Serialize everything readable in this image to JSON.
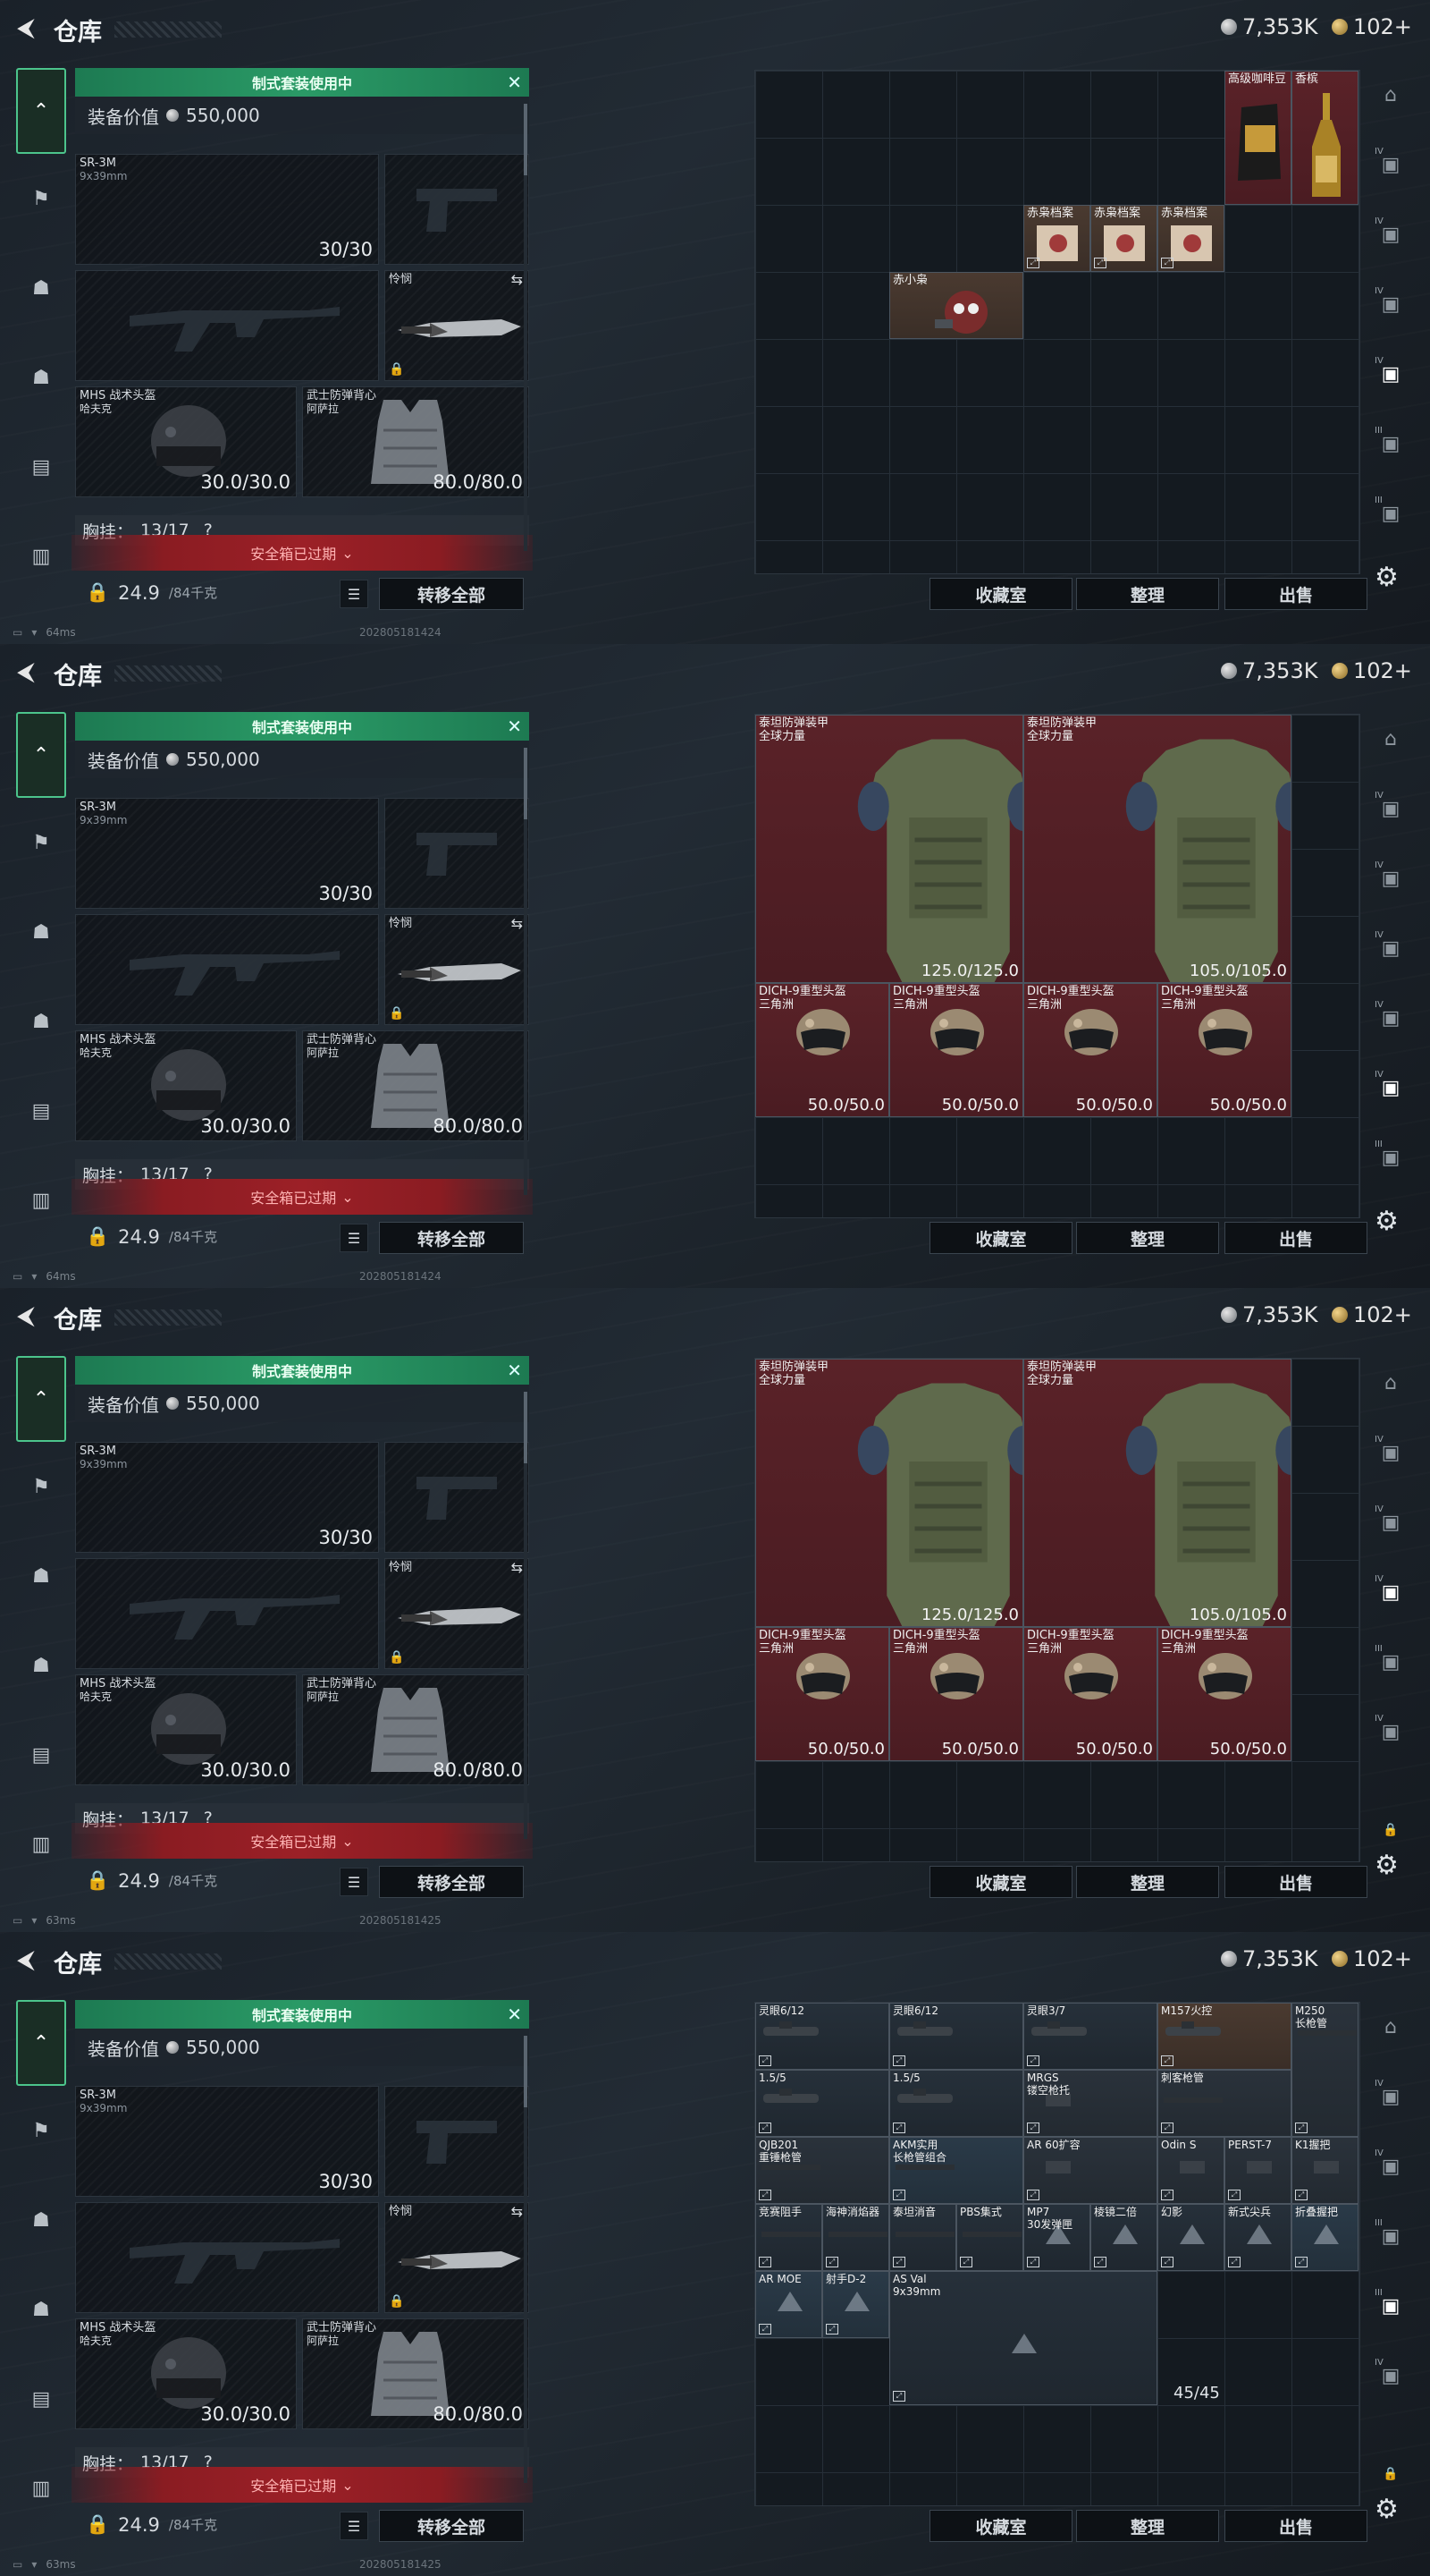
{
  "header": {
    "title": "仓库",
    "currency_silver": "7,353K",
    "currency_gold": "102+"
  },
  "loadout": {
    "kit_banner": "制式套装使用中",
    "value_label": "装备价值",
    "value": "550,000",
    "primary": {
      "name": "SR-3M",
      "caliber": "9x39mm",
      "ammo": "30/30"
    },
    "melee": {
      "name": "怜悯"
    },
    "helmet": {
      "name": "MHS 战术头盔",
      "sub": "哈夫克",
      "durability": "30.0/30.0"
    },
    "armor": {
      "name": "武士防弹背心",
      "sub": "阿萨拉",
      "durability": "80.0/80.0"
    },
    "chest_label": "胸挂：",
    "chest_value": "13/17",
    "chest_q": "?",
    "expired": "安全箱已过期",
    "weight": "24.9",
    "weight_unit": "/84千克",
    "transfer_all": "转移全部"
  },
  "grid_buttons": {
    "collection": "收藏室",
    "sort": "整理",
    "sell": "出售"
  },
  "panels": [
    {
      "ping": "64ms",
      "stamp": "202805181424",
      "items": [
        {
          "name": "高级咖啡豆"
        },
        {
          "name": "香槟"
        },
        {
          "name": "赤枭档案"
        },
        {
          "name": "赤枭档案"
        },
        {
          "name": "赤枭档案"
        },
        {
          "name": "赤小枭"
        }
      ]
    },
    {
      "ping": "64ms",
      "stamp": "202805181424",
      "items": [
        {
          "name": "泰坦防弹装甲",
          "sub": "全球力量",
          "val": "125.0/125.0"
        },
        {
          "name": "泰坦防弹装甲",
          "sub": "全球力量",
          "val": "105.0/105.0"
        },
        {
          "name": "DICH-9重型头盔",
          "sub": "三角洲",
          "val": "50.0/50.0"
        },
        {
          "name": "DICH-9重型头盔",
          "sub": "三角洲",
          "val": "50.0/50.0"
        },
        {
          "name": "DICH-9重型头盔",
          "sub": "三角洲",
          "val": "50.0/50.0"
        },
        {
          "name": "DICH-9重型头盔",
          "sub": "三角洲",
          "val": "50.0/50.0"
        }
      ]
    },
    {
      "ping": "63ms",
      "stamp": "202805181425",
      "items": [
        {
          "name": "泰坦防弹装甲",
          "sub": "全球力量",
          "val": "125.0/125.0"
        },
        {
          "name": "泰坦防弹装甲",
          "sub": "全球力量",
          "val": "105.0/105.0"
        },
        {
          "name": "DICH-9重型头盔",
          "sub": "三角洲",
          "val": "50.0/50.0"
        },
        {
          "name": "DICH-9重型头盔",
          "sub": "三角洲",
          "val": "50.0/50.0"
        },
        {
          "name": "DICH-9重型头盔",
          "sub": "三角洲",
          "val": "50.0/50.0"
        },
        {
          "name": "DICH-9重型头盔",
          "sub": "三角洲",
          "val": "50.0/50.0"
        }
      ]
    },
    {
      "ping": "63ms",
      "stamp": "202805181425",
      "count": "45/45",
      "items": [
        {
          "name": "灵眼6/12"
        },
        {
          "name": "灵眼6/12"
        },
        {
          "name": "灵眼3/7"
        },
        {
          "name": "M157火控"
        },
        {
          "name": "M250",
          "sub": "长枪管"
        },
        {
          "name": "1.5/5"
        },
        {
          "name": "1.5/5"
        },
        {
          "name": "MRGS",
          "sub": "镂空枪托"
        },
        {
          "name": "刺客枪管"
        },
        {
          "name": "QJB201",
          "sub": "重锤枪管"
        },
        {
          "name": "AKM实用",
          "sub": "长枪管组合"
        },
        {
          "name": "AR 60扩容"
        },
        {
          "name": "Odin S"
        },
        {
          "name": "PERST-7"
        },
        {
          "name": "K1握把"
        },
        {
          "name": "竞赛阻手"
        },
        {
          "name": "海神消焰器"
        },
        {
          "name": "泰坦消音"
        },
        {
          "name": "PBS集式"
        },
        {
          "name": "MP7",
          "sub": "30发弹匣"
        },
        {
          "name": "棱镜二倍"
        },
        {
          "name": "幻影"
        },
        {
          "name": "新式尖兵"
        },
        {
          "name": "折叠握把"
        },
        {
          "name": "AR MOE"
        },
        {
          "name": "射手D-2"
        },
        {
          "name": "AS Val",
          "sub": "9x39mm"
        }
      ]
    }
  ]
}
